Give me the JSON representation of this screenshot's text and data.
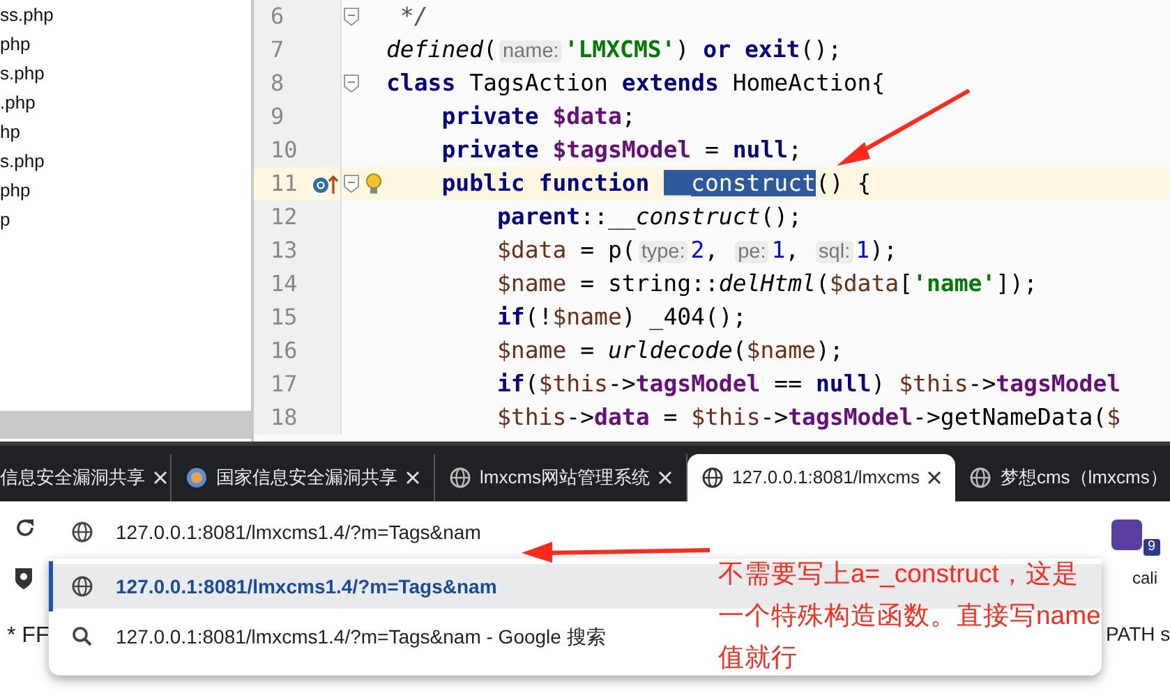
{
  "project_files": [
    "ss.php",
    "php",
    "s.php",
    ".php",
    "hp",
    "s.php",
    "php",
    "p"
  ],
  "editor": {
    "lines": [
      {
        "number": "6",
        "highlighted": false,
        "fold": true,
        "override": false,
        "bulb": false,
        "segments": [
          {
            "text": " */",
            "kind": "comment"
          }
        ]
      },
      {
        "number": "7",
        "highlighted": false,
        "fold": false,
        "override": false,
        "bulb": false,
        "segments": [
          {
            "text": "defined",
            "kind": "fn"
          },
          {
            "text": "(",
            "kind": "plain"
          },
          {
            "text": "name:",
            "kind": "hint"
          },
          {
            "text": "'LMXCMS'",
            "kind": "str"
          },
          {
            "text": ") ",
            "kind": "plain"
          },
          {
            "text": "or exit",
            "kind": "kw"
          },
          {
            "text": "();",
            "kind": "plain"
          }
        ]
      },
      {
        "number": "8",
        "highlighted": false,
        "fold": true,
        "override": false,
        "bulb": false,
        "segments": [
          {
            "text": "class ",
            "kind": "kw"
          },
          {
            "text": "TagsAction ",
            "kind": "plain"
          },
          {
            "text": "extends ",
            "kind": "kw"
          },
          {
            "text": "HomeAction{",
            "kind": "plain"
          }
        ]
      },
      {
        "number": "9",
        "highlighted": false,
        "fold": false,
        "override": false,
        "bulb": false,
        "segments": [
          {
            "text": "    private ",
            "kind": "kw"
          },
          {
            "text": "$data",
            "kind": "field"
          },
          {
            "text": ";",
            "kind": "plain"
          }
        ]
      },
      {
        "number": "10",
        "highlighted": false,
        "fold": false,
        "override": false,
        "bulb": false,
        "segments": [
          {
            "text": "    private ",
            "kind": "kw"
          },
          {
            "text": "$tagsModel",
            "kind": "field"
          },
          {
            "text": " = ",
            "kind": "plain"
          },
          {
            "text": "null",
            "kind": "kw"
          },
          {
            "text": ";",
            "kind": "plain"
          }
        ]
      },
      {
        "number": "11",
        "highlighted": true,
        "fold": true,
        "override": true,
        "bulb": true,
        "segments": [
          {
            "text": "    public function ",
            "kind": "kw"
          },
          {
            "text": "__construct",
            "kind": "selected"
          },
          {
            "text": "() {",
            "kind": "plain"
          }
        ]
      },
      {
        "number": "12",
        "highlighted": false,
        "fold": false,
        "override": false,
        "bulb": false,
        "segments": [
          {
            "text": "        parent",
            "kind": "kw"
          },
          {
            "text": "::",
            "kind": "plain"
          },
          {
            "text": "__construct",
            "kind": "fn"
          },
          {
            "text": "();",
            "kind": "plain"
          }
        ]
      },
      {
        "number": "13",
        "highlighted": false,
        "fold": false,
        "override": false,
        "bulb": false,
        "segments": [
          {
            "text": "        $data",
            "kind": "var"
          },
          {
            "text": " = p(",
            "kind": "plain"
          },
          {
            "text": "type:",
            "kind": "hint"
          },
          {
            "text": "2",
            "kind": "num"
          },
          {
            "text": ", ",
            "kind": "plain"
          },
          {
            "text": "pe:",
            "kind": "hint"
          },
          {
            "text": "1",
            "kind": "num"
          },
          {
            "text": ", ",
            "kind": "plain"
          },
          {
            "text": "sql:",
            "kind": "hint"
          },
          {
            "text": "1",
            "kind": "num"
          },
          {
            "text": ");",
            "kind": "plain"
          }
        ]
      },
      {
        "number": "14",
        "highlighted": false,
        "fold": false,
        "override": false,
        "bulb": false,
        "segments": [
          {
            "text": "        $name",
            "kind": "var"
          },
          {
            "text": " = string::",
            "kind": "plain"
          },
          {
            "text": "delHtml",
            "kind": "fn"
          },
          {
            "text": "(",
            "kind": "plain"
          },
          {
            "text": "$data",
            "kind": "var"
          },
          {
            "text": "[",
            "kind": "plain"
          },
          {
            "text": "'name'",
            "kind": "str"
          },
          {
            "text": "]);",
            "kind": "plain"
          }
        ]
      },
      {
        "number": "15",
        "highlighted": false,
        "fold": false,
        "override": false,
        "bulb": false,
        "segments": [
          {
            "text": "        if",
            "kind": "kw"
          },
          {
            "text": "(!",
            "kind": "plain"
          },
          {
            "text": "$name",
            "kind": "var"
          },
          {
            "text": ") _404();",
            "kind": "plain"
          }
        ]
      },
      {
        "number": "16",
        "highlighted": false,
        "fold": false,
        "override": false,
        "bulb": false,
        "segments": [
          {
            "text": "        $name",
            "kind": "var"
          },
          {
            "text": " = ",
            "kind": "plain"
          },
          {
            "text": "urldecode",
            "kind": "fn"
          },
          {
            "text": "(",
            "kind": "plain"
          },
          {
            "text": "$name",
            "kind": "var"
          },
          {
            "text": ");",
            "kind": "plain"
          }
        ]
      },
      {
        "number": "17",
        "highlighted": false,
        "fold": false,
        "override": false,
        "bulb": false,
        "segments": [
          {
            "text": "        if",
            "kind": "kw"
          },
          {
            "text": "(",
            "kind": "plain"
          },
          {
            "text": "$this",
            "kind": "var"
          },
          {
            "text": "->",
            "kind": "plain"
          },
          {
            "text": "tagsModel",
            "kind": "field"
          },
          {
            "text": " == ",
            "kind": "plain"
          },
          {
            "text": "null",
            "kind": "kw"
          },
          {
            "text": ") ",
            "kind": "plain"
          },
          {
            "text": "$this",
            "kind": "var"
          },
          {
            "text": "->",
            "kind": "plain"
          },
          {
            "text": "tagsModel",
            "kind": "field"
          }
        ]
      },
      {
        "number": "18",
        "highlighted": false,
        "fold": false,
        "override": false,
        "bulb": false,
        "segments": [
          {
            "text": "        $this",
            "kind": "var"
          },
          {
            "text": "->",
            "kind": "plain"
          },
          {
            "text": "data",
            "kind": "field"
          },
          {
            "text": " = ",
            "kind": "plain"
          },
          {
            "text": "$this",
            "kind": "var"
          },
          {
            "text": "->",
            "kind": "plain"
          },
          {
            "text": "tagsModel",
            "kind": "field"
          },
          {
            "text": "->getNameData(",
            "kind": "plain"
          },
          {
            "text": "$",
            "kind": "var"
          }
        ]
      }
    ]
  },
  "browser": {
    "tabs": [
      {
        "title": "信息安全漏洞共享",
        "kind": "plain",
        "selected": false,
        "closable": true
      },
      {
        "title": "国家信息安全漏洞共享",
        "kind": "logo",
        "selected": false,
        "closable": true
      },
      {
        "title": "lmxcms网站管理系统",
        "kind": "globe",
        "selected": false,
        "closable": true
      },
      {
        "title": "127.0.0.1:8081/lmxcms",
        "kind": "globe",
        "selected": true,
        "closable": true
      },
      {
        "title": "梦想cms（lmxcms）",
        "kind": "globe",
        "selected": false,
        "closable": false
      }
    ],
    "address": {
      "value": "127.0.0.1:8081/lmxcms1.4/?m=Tags&nam"
    },
    "suggestions": [
      {
        "text": "127.0.0.1:8081/lmxcms1.4/?m=Tags&nam",
        "kind": "url",
        "selected": true
      },
      {
        "text": "127.0.0.1:8081/lmxcms1.4/?m=Tags&nam - Google 搜索",
        "kind": "search",
        "selected": false
      }
    ],
    "extension_badge": "9",
    "bookmark_text": "cali",
    "page_text_left": "* FF",
    "page_text_right": "PATH s"
  },
  "annotation": {
    "text": "不需要写上a=_construct，这是一个特殊构造函数。直接写name值就行"
  }
}
